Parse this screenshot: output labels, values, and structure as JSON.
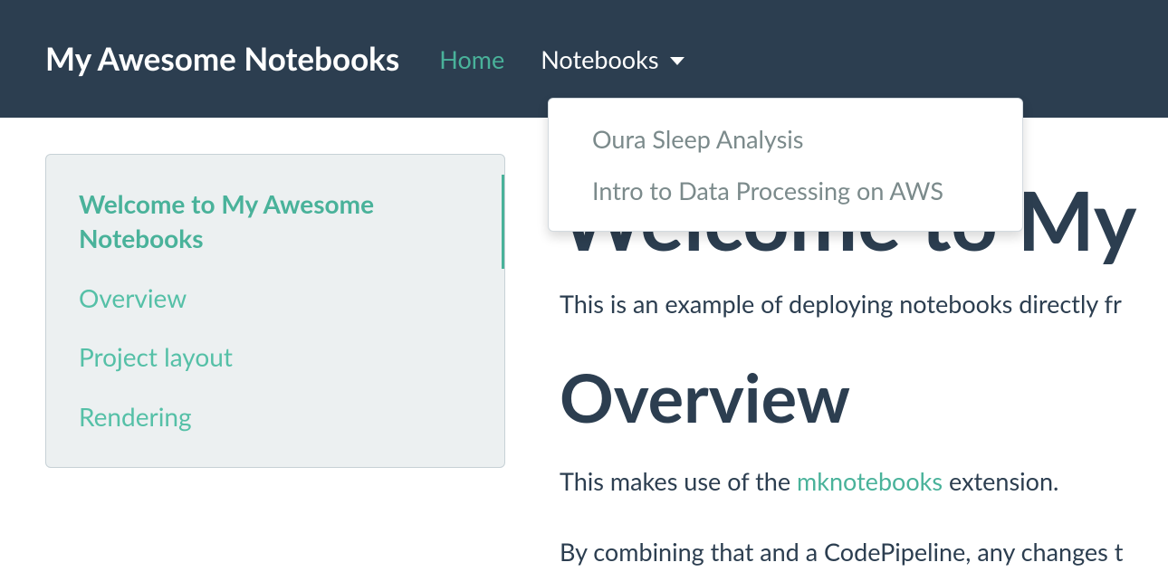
{
  "navbar": {
    "brand": "My Awesome Notebooks",
    "home": "Home",
    "notebooks": "Notebooks"
  },
  "dropdown": {
    "item0": "Oura Sleep Analysis",
    "item1": "Intro to Data Processing on AWS"
  },
  "toc": {
    "item0": "Welcome to My Awesome Notebooks",
    "item1": "Overview",
    "item2": "Project layout",
    "item3": "Rendering"
  },
  "content": {
    "h1_partial": "Welcome to My",
    "p1": "This is an example of deploying notebooks directly fr",
    "h2": "Overview",
    "p2a": "This makes use of the ",
    "p2link": "mknotebooks",
    "p2b": " extension.",
    "p3": "By combining that and a CodePipeline, any changes t"
  }
}
